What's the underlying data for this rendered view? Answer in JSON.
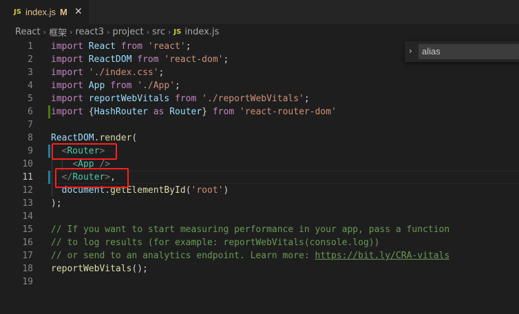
{
  "tab": {
    "badge": "JS",
    "name": "index.js",
    "status": "M",
    "close": "✕"
  },
  "breadcrumb": {
    "items": [
      "React",
      "框架",
      "react3",
      "project",
      "src"
    ],
    "file_badge": "JS",
    "file": "index.js",
    "separator": "›"
  },
  "find": {
    "toggle": "›",
    "value": "alias"
  },
  "editor": {
    "active_line": 11,
    "gutter_modified_lines": [
      9,
      11
    ],
    "gutter_added_lines": [
      6
    ],
    "lines": [
      {
        "n": "1",
        "tokens": [
          [
            "kw",
            "import"
          ],
          [
            "plain",
            " "
          ],
          [
            "var",
            "React"
          ],
          [
            "plain",
            " "
          ],
          [
            "kw",
            "from"
          ],
          [
            "plain",
            " "
          ],
          [
            "str",
            "'react'"
          ],
          [
            "plain",
            ";"
          ]
        ]
      },
      {
        "n": "2",
        "tokens": [
          [
            "kw",
            "import"
          ],
          [
            "plain",
            " "
          ],
          [
            "var",
            "ReactDOM"
          ],
          [
            "plain",
            " "
          ],
          [
            "kw",
            "from"
          ],
          [
            "plain",
            " "
          ],
          [
            "str",
            "'react-dom'"
          ],
          [
            "plain",
            ";"
          ]
        ]
      },
      {
        "n": "3",
        "tokens": [
          [
            "kw",
            "import"
          ],
          [
            "plain",
            " "
          ],
          [
            "str",
            "'./index.css'"
          ],
          [
            "plain",
            ";"
          ]
        ]
      },
      {
        "n": "4",
        "tokens": [
          [
            "kw",
            "import"
          ],
          [
            "plain",
            " "
          ],
          [
            "var",
            "App"
          ],
          [
            "plain",
            " "
          ],
          [
            "kw",
            "from"
          ],
          [
            "plain",
            " "
          ],
          [
            "str",
            "'./App'"
          ],
          [
            "plain",
            ";"
          ]
        ]
      },
      {
        "n": "5",
        "tokens": [
          [
            "kw",
            "import"
          ],
          [
            "plain",
            " "
          ],
          [
            "var",
            "reportWebVitals"
          ],
          [
            "plain",
            " "
          ],
          [
            "kw",
            "from"
          ],
          [
            "plain",
            " "
          ],
          [
            "str",
            "'./reportWebVitals'"
          ],
          [
            "plain",
            ";"
          ]
        ]
      },
      {
        "n": "6",
        "tokens": [
          [
            "kw",
            "import"
          ],
          [
            "plain",
            " {"
          ],
          [
            "var",
            "HashRouter"
          ],
          [
            "plain",
            " "
          ],
          [
            "kw",
            "as"
          ],
          [
            "plain",
            " "
          ],
          [
            "var",
            "Router"
          ],
          [
            "plain",
            "} "
          ],
          [
            "kw",
            "from"
          ],
          [
            "plain",
            " "
          ],
          [
            "str",
            "'react-router-dom'"
          ]
        ]
      },
      {
        "n": "7",
        "tokens": []
      },
      {
        "n": "8",
        "tokens": [
          [
            "var",
            "ReactDOM"
          ],
          [
            "plain",
            "."
          ],
          [
            "fn",
            "render"
          ],
          [
            "plain",
            "("
          ]
        ]
      },
      {
        "n": "9",
        "tokens": [
          [
            "plain",
            "  "
          ],
          [
            "punc",
            "<"
          ],
          [
            "tag",
            "Router"
          ],
          [
            "punc",
            ">"
          ]
        ]
      },
      {
        "n": "10",
        "tokens": [
          [
            "plain",
            "    "
          ],
          [
            "punc",
            "<"
          ],
          [
            "tag",
            "App"
          ],
          [
            "plain",
            " "
          ],
          [
            "punc",
            "/>"
          ]
        ]
      },
      {
        "n": "11",
        "tokens": [
          [
            "plain",
            "  "
          ],
          [
            "punc",
            "</"
          ],
          [
            "tag",
            "Router"
          ],
          [
            "punc",
            ">"
          ],
          [
            "plain",
            ","
          ]
        ]
      },
      {
        "n": "12",
        "tokens": [
          [
            "plain",
            "  "
          ],
          [
            "var",
            "document"
          ],
          [
            "plain",
            "."
          ],
          [
            "fn",
            "getElementById"
          ],
          [
            "plain",
            "("
          ],
          [
            "str",
            "'root'"
          ],
          [
            "plain",
            ")"
          ]
        ]
      },
      {
        "n": "13",
        "tokens": [
          [
            "plain",
            ");"
          ]
        ]
      },
      {
        "n": "14",
        "tokens": []
      },
      {
        "n": "15",
        "tokens": [
          [
            "com",
            "// If you want to start measuring performance in your app, pass a function"
          ]
        ]
      },
      {
        "n": "16",
        "tokens": [
          [
            "com",
            "// to log results (for example: reportWebVitals(console.log))"
          ]
        ]
      },
      {
        "n": "17",
        "tokens": [
          [
            "com",
            "// or send to an analytics endpoint. Learn more: "
          ],
          [
            "link",
            "https://bit.ly/CRA-vitals"
          ]
        ]
      },
      {
        "n": "18",
        "tokens": [
          [
            "fn",
            "reportWebVitals"
          ],
          [
            "plain",
            "();"
          ]
        ]
      },
      {
        "n": "19",
        "tokens": []
      }
    ]
  },
  "colors": {
    "background": "#1e1e1e",
    "keyword": "#c586c0",
    "variable": "#9cdcfe",
    "string": "#ce9178",
    "function": "#dcdcaa",
    "jsx_tag": "#4ec9b0",
    "comment": "#6a9955",
    "highlight_box": "#ff2020"
  }
}
